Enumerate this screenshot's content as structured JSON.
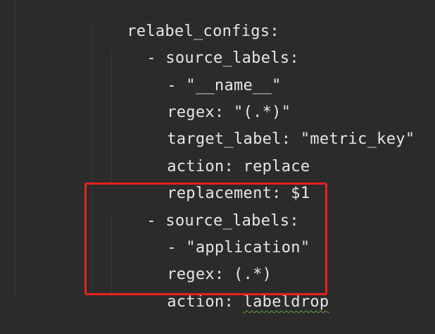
{
  "editor": {
    "lines": [
      {
        "text": "relabel_configs:"
      },
      {
        "text": "- source_labels:"
      },
      {
        "text": "- \"__name__\""
      },
      {
        "text": "regex: \"(.*)\""
      },
      {
        "text": "target_label: \"metric_key\""
      },
      {
        "text": "action: replace"
      },
      {
        "text": "replacement: $1"
      },
      {
        "text": "- source_labels:"
      },
      {
        "text": "- \"application\""
      },
      {
        "text": "regex: (.*)"
      },
      {
        "text": "action: "
      },
      {
        "text": "labeldrop"
      }
    ]
  },
  "colors": {
    "background": "#2b2b2b",
    "text": "#e6e6e6",
    "highlight_border": "#e8221c",
    "spellcheck_underline": "#5f9e3f"
  }
}
